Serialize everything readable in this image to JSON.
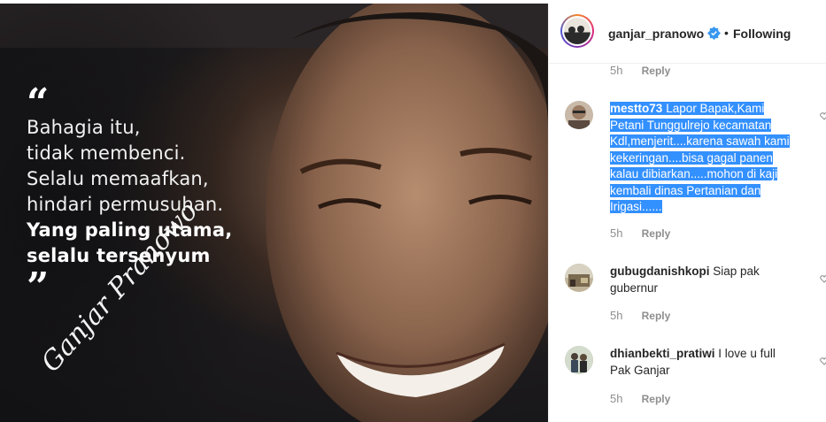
{
  "post": {
    "quote_lines": [
      "Bahagia itu,",
      "tidak membenci.",
      "Selalu memaafkan,",
      "hindari permusuhan."
    ],
    "quote_bold_lines": [
      "Yang paling utama,",
      "selalu tersenyum"
    ],
    "open_quote": "“",
    "close_quote": "”",
    "signature": "Ganjar Pranowo"
  },
  "header": {
    "username": "ganjar_pranowo",
    "separator": "•",
    "follow_status": "Following"
  },
  "comments": [
    {
      "time": "5h",
      "reply_label": "Reply"
    },
    {
      "username": "mestto73",
      "text_lines": [
        "Lapor Bapak,Kami",
        "Petani Tunggulrejo kecamatan",
        "Kdl,menjerit....karena sawah kami",
        "kekeringan....bisa gagal panen",
        "kalau dibiarkan.....mohon di kaji",
        "kembali dinas Pertanian dan",
        "Irigasi......"
      ],
      "time": "5h",
      "reply_label": "Reply",
      "selected": true
    },
    {
      "username": "gubugdanishkopi",
      "text_first": "Siap pak",
      "text_rest": "gubernur",
      "time": "5h",
      "reply_label": "Reply"
    },
    {
      "username": "dhianbekti_pratiwi",
      "text_first": "I love u full",
      "text_rest": "Pak Ganjar",
      "time": "5h",
      "reply_label": "Reply"
    }
  ],
  "colors": {
    "selection": "#3390ff",
    "verified": "#3897f0",
    "muted": "#8e8e8e",
    "text": "#262626"
  }
}
